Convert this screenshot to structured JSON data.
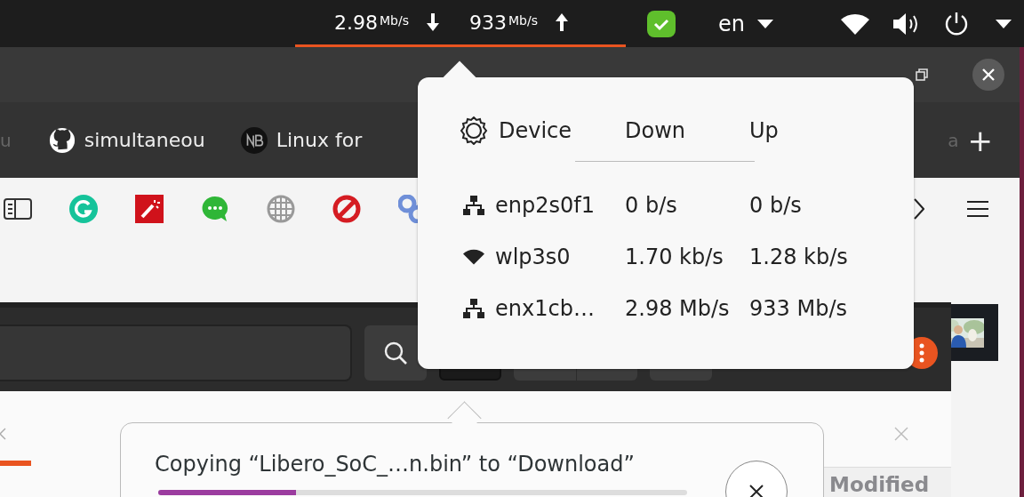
{
  "top_bar": {
    "net_speed": {
      "down": "2.98",
      "down_unit": "Mb/s",
      "up": "933",
      "up_unit": "Mb/s",
      "selected": true
    },
    "language": "en"
  },
  "browser": {
    "tabs": [
      {
        "label": "u",
        "kind": "plain"
      },
      {
        "label": "simultaneou",
        "kind": "github"
      },
      {
        "label": "Linux for",
        "kind": "nb"
      },
      {
        "label": "a",
        "kind": "plain"
      }
    ],
    "new_tab": "+"
  },
  "file_manager": {
    "progress": {
      "message": "Copying “Libero_SoC_…n.bin” to “Download”",
      "level": 0.26
    },
    "column_header": "Modified"
  },
  "network_menu": {
    "columns": [
      "Device",
      "Down",
      "Up"
    ],
    "devices": [
      {
        "kind": "wired",
        "name": "enp2s0f1",
        "down": "0 b/s",
        "up": "0 b/s"
      },
      {
        "kind": "wireless",
        "name": "wlp3s0",
        "down": "1.70 kb/s",
        "up": "1.28 kb/s"
      },
      {
        "kind": "wired",
        "name": "enx1cb…",
        "down": "2.98 Mb/s",
        "up": "933 Mb/s"
      }
    ]
  }
}
